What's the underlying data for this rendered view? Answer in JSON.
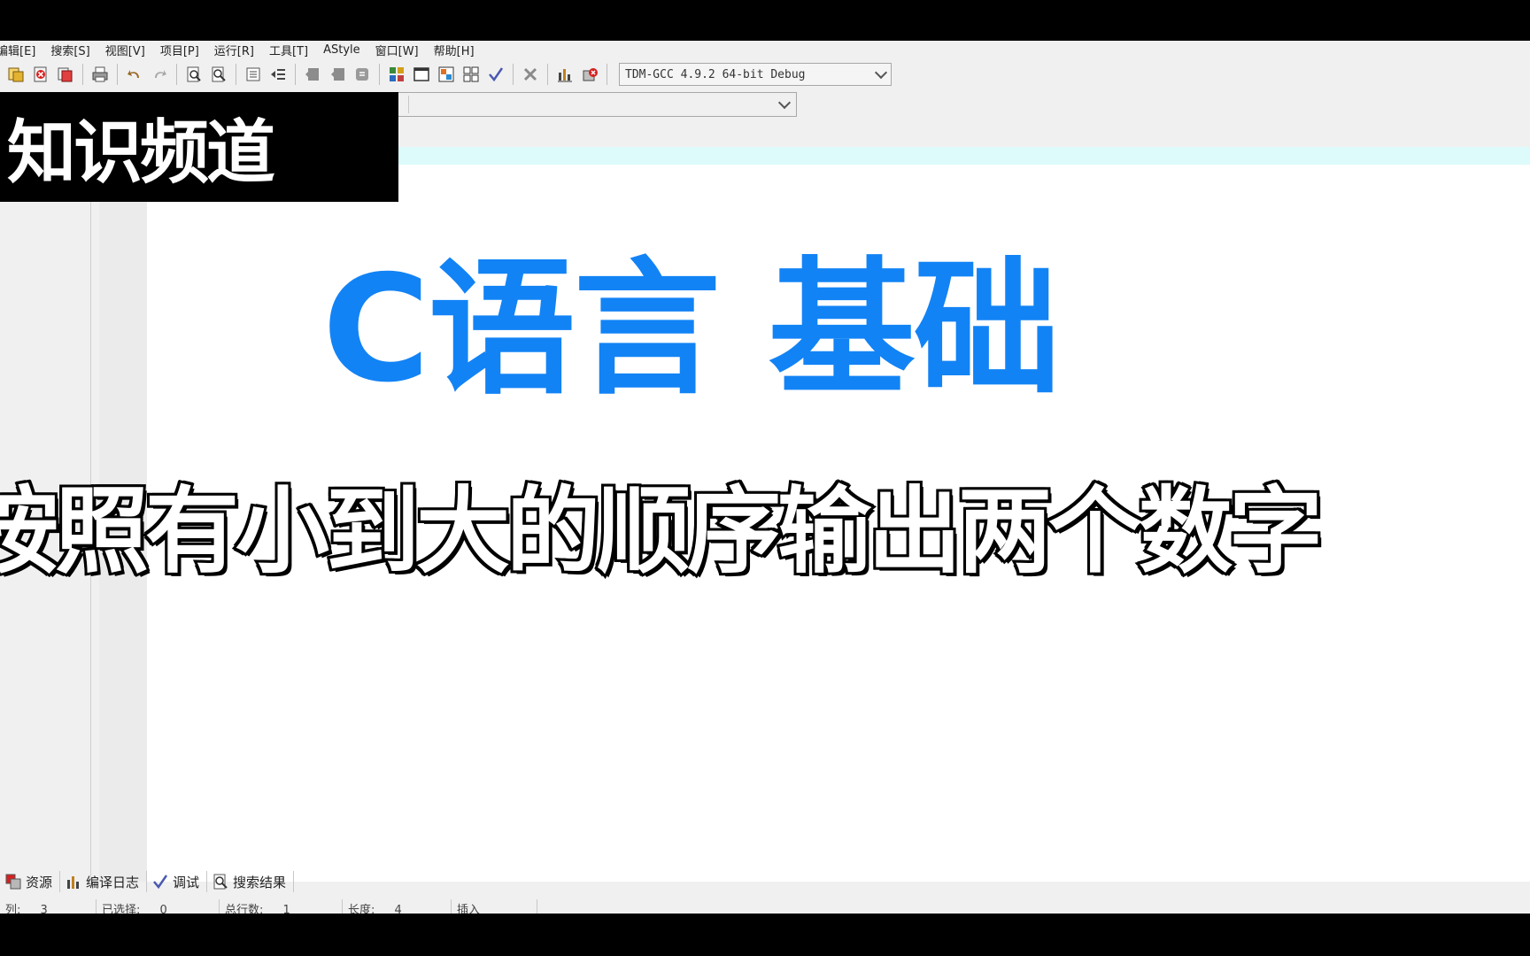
{
  "menu": [
    "编辑[E]",
    "搜索[S]",
    "视图[V]",
    "项目[P]",
    "运行[R]",
    "工具[T]",
    "AStyle",
    "窗口[W]",
    "帮助[H]"
  ],
  "toolbar": {
    "icons": [
      "new-project-icon",
      "close-icon",
      "close-all-icon",
      "print-icon",
      "undo-icon",
      "redo-icon",
      "find-icon",
      "find-replace-icon",
      "indent-icon",
      "unindent-icon",
      "back-icon",
      "forward-icon",
      "bookmark-icon",
      "project-view-icon",
      "window-icon",
      "color-icon",
      "layout-icon",
      "check-icon",
      "delete-icon",
      "chart-icon",
      "debug-stop-icon"
    ],
    "compiler": "TDM-GCC 4.9.2 64-bit Debug"
  },
  "overlay": {
    "channel": "知识频道",
    "headline": "C语言 基础",
    "subtitle": "按照有小到大的顺序输出两个数字"
  },
  "bottom_tabs": [
    {
      "label": "资源",
      "icon": "resources-icon"
    },
    {
      "label": "编译日志",
      "icon": "compile-log-icon"
    },
    {
      "label": "调试",
      "icon": "debug-check-icon"
    },
    {
      "label": "搜索结果",
      "icon": "search-results-icon"
    }
  ],
  "statusbar": {
    "col_label": "列:",
    "col_value": "3",
    "sel_label": "已选择:",
    "sel_value": "0",
    "lines_label": "总行数:",
    "lines_value": "1",
    "len_label": "长度:",
    "len_value": "4",
    "mode": "插入"
  },
  "colors": {
    "headline": "#1283f5",
    "editor_strip": "#ddfbfb"
  }
}
